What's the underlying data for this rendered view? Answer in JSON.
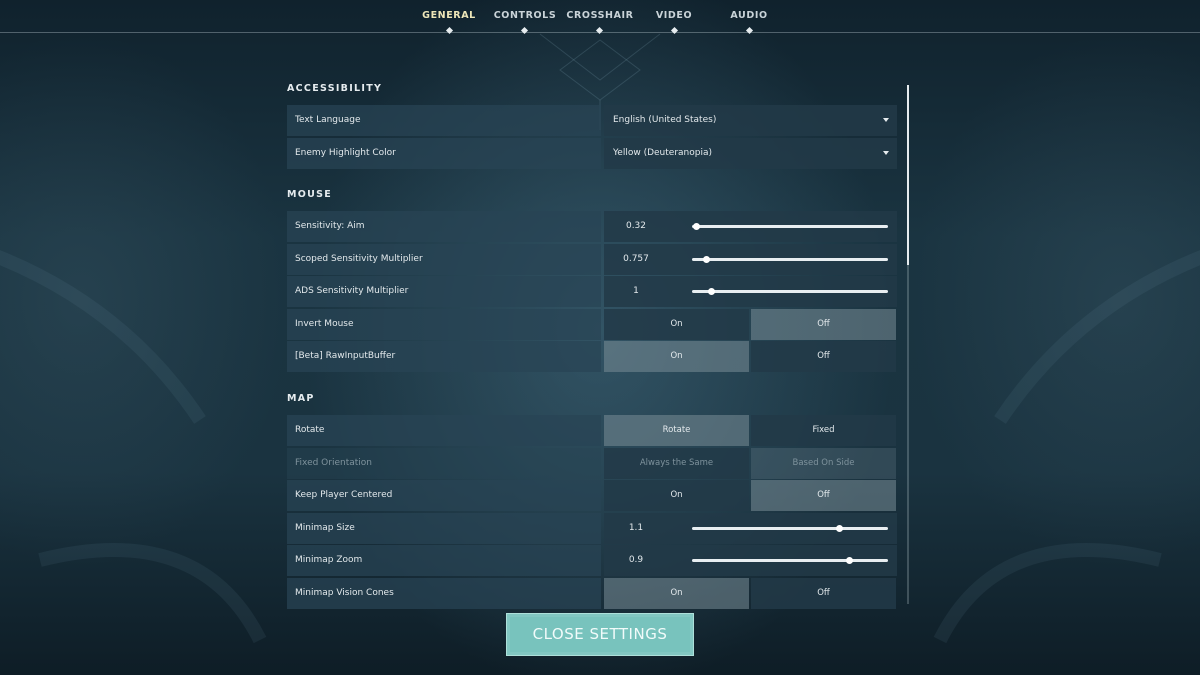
{
  "nav": {
    "tabs": [
      {
        "label": "GENERAL",
        "active": true
      },
      {
        "label": "CONTROLS",
        "active": false
      },
      {
        "label": "CROSSHAIR",
        "active": false
      },
      {
        "label": "VIDEO",
        "active": false
      },
      {
        "label": "AUDIO",
        "active": false
      }
    ]
  },
  "accessibility": {
    "title": "ACCESSIBILITY",
    "text_language": {
      "label": "Text Language",
      "value": "English (United States)"
    },
    "enemy_highlight": {
      "label": "Enemy Highlight Color",
      "value": "Yellow (Deuteranopia)"
    }
  },
  "mouse": {
    "title": "MOUSE",
    "sens_aim": {
      "label": "Sensitivity: Aim",
      "value": "0.32",
      "fraction": 0.02
    },
    "scoped_mult": {
      "label": "Scoped Sensitivity Multiplier",
      "value": "0.757",
      "fraction": 0.07
    },
    "ads_mult": {
      "label": "ADS Sensitivity Multiplier",
      "value": "1",
      "fraction": 0.095
    },
    "invert": {
      "label": "Invert Mouse",
      "on": "On",
      "off": "Off",
      "selected": "off"
    },
    "raw_input": {
      "label": "[Beta] RawInputBuffer",
      "on": "On",
      "off": "Off",
      "selected": "on"
    }
  },
  "map": {
    "title": "MAP",
    "rotate": {
      "label": "Rotate",
      "left": "Rotate",
      "right": "Fixed",
      "selected": "left"
    },
    "fixed_orientation": {
      "label": "Fixed Orientation",
      "left": "Always the Same",
      "right": "Based On Side",
      "selected": "right"
    },
    "keep_centered": {
      "label": "Keep Player Centered",
      "on": "On",
      "off": "Off",
      "selected": "off"
    },
    "minimap_size": {
      "label": "Minimap Size",
      "value": "1.1",
      "fraction": 0.75
    },
    "minimap_zoom": {
      "label": "Minimap Zoom",
      "value": "0.9",
      "fraction": 0.8
    },
    "vision_cones": {
      "label": "Minimap Vision Cones",
      "on": "On",
      "off": "Off",
      "selected": "on"
    }
  },
  "close_button": {
    "label": "CLOSE SETTINGS"
  },
  "colors": {
    "accent": "#78c3bd",
    "active_tab": "#ede6b8"
  }
}
